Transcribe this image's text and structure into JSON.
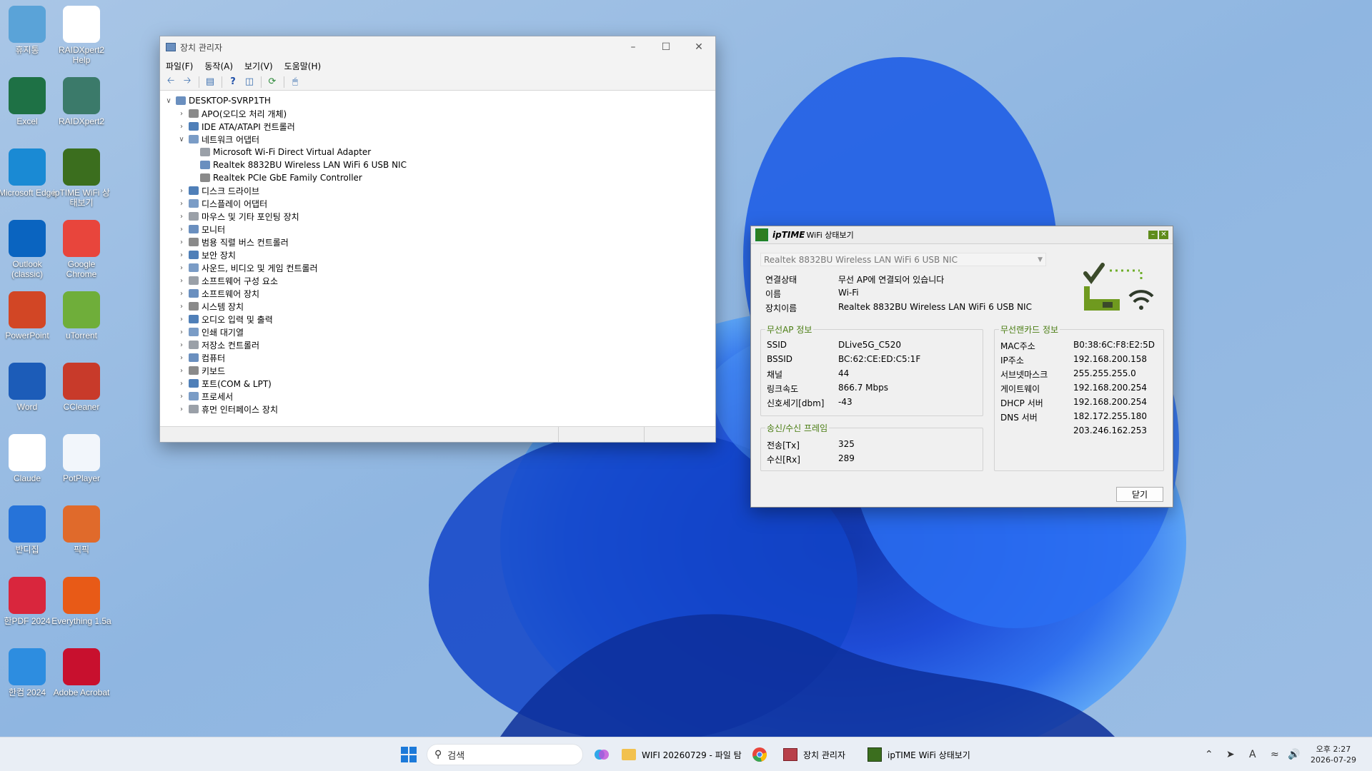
{
  "desktop": {
    "icons": [
      {
        "label": "휴지통",
        "icon": "recycle-bin-icon",
        "color": "#5aa3d8"
      },
      {
        "label": "RAIDXpert2 Help",
        "icon": "pdf-icon",
        "color": "#ffffff"
      },
      {
        "label": "Excel",
        "icon": "excel-icon",
        "color": "#1e7145"
      },
      {
        "label": "RAIDXpert2",
        "icon": "raidxpert-icon",
        "color": "#3b7a6a"
      },
      {
        "label": "Microsoft Edge",
        "icon": "edge-icon",
        "color": "#1a8ad4"
      },
      {
        "label": "ipTIME WiFi 상태보기",
        "icon": "iptime-icon",
        "color": "#3b6e1e"
      },
      {
        "label": "Outlook (classic)",
        "icon": "outlook-icon",
        "color": "#0a64c0"
      },
      {
        "label": "Google Chrome",
        "icon": "chrome-icon",
        "color": "#e8453c"
      },
      {
        "label": "PowerPoint",
        "icon": "powerpoint-icon",
        "color": "#d24625"
      },
      {
        "label": "uTorrent",
        "icon": "utorrent-icon",
        "color": "#6fae3a"
      },
      {
        "label": "Word",
        "icon": "word-icon",
        "color": "#1c5cb8"
      },
      {
        "label": "CCleaner",
        "icon": "ccleaner-icon",
        "color": "#c83a2a"
      },
      {
        "label": "Claude",
        "icon": "claude-icon",
        "color": "#ffffff"
      },
      {
        "label": "PotPlayer",
        "icon": "potplayer-icon",
        "color": "#f2f6fb"
      },
      {
        "label": "한PDF 2024",
        "icon": "hanpdf-icon",
        "color": "#d9263d"
      },
      {
        "label": "Everything 1.5a",
        "icon": "everything-icon",
        "color": "#e85a17"
      },
      {
        "label": "한컴 2024",
        "icon": "hancom-icon",
        "color": "#2d8de0"
      },
      {
        "label": "Adobe Acrobat",
        "icon": "acrobat-icon",
        "color": "#c8102e"
      },
      {
        "label": "반디집",
        "icon": "bandizip-icon",
        "color": "#2673d9"
      },
      {
        "label": "픽픽",
        "icon": "picpick-icon",
        "color": "#e06a2b"
      }
    ]
  },
  "devmgr": {
    "title": "장치 관리자",
    "menu": [
      "파일(F)",
      "동작(A)",
      "보기(V)",
      "도움말(H)"
    ],
    "tree": [
      {
        "label": "DESKTOP-SVRP1TH",
        "level": 0,
        "exp": "v"
      },
      {
        "label": "APO(오디오 처리 개체)",
        "level": 1,
        "exp": ">"
      },
      {
        "label": "IDE ATA/ATAPI 컨트롤러",
        "level": 1,
        "exp": ">"
      },
      {
        "label": "네트워크 어댑터",
        "level": 1,
        "exp": "v"
      },
      {
        "label": "Microsoft Wi-Fi Direct Virtual Adapter",
        "level": 2,
        "exp": ""
      },
      {
        "label": "Realtek 8832BU Wireless LAN WiFi 6 USB NIC",
        "level": 2,
        "exp": ""
      },
      {
        "label": "Realtek PCIe GbE Family Controller",
        "level": 2,
        "exp": ""
      },
      {
        "label": "디스크 드라이브",
        "level": 1,
        "exp": ">"
      },
      {
        "label": "디스플레이 어댑터",
        "level": 1,
        "exp": ">"
      },
      {
        "label": "마우스 및 기타 포인팅 장치",
        "level": 1,
        "exp": ">"
      },
      {
        "label": "모니터",
        "level": 1,
        "exp": ">"
      },
      {
        "label": "범용 직렬 버스 컨트롤러",
        "level": 1,
        "exp": ">"
      },
      {
        "label": "보안 장치",
        "level": 1,
        "exp": ">"
      },
      {
        "label": "사운드, 비디오 및 게임 컨트롤러",
        "level": 1,
        "exp": ">"
      },
      {
        "label": "소프트웨어 구성 요소",
        "level": 1,
        "exp": ">"
      },
      {
        "label": "소프트웨어 장치",
        "level": 1,
        "exp": ">"
      },
      {
        "label": "시스템 장치",
        "level": 1,
        "exp": ">"
      },
      {
        "label": "오디오 입력 및 출력",
        "level": 1,
        "exp": ">"
      },
      {
        "label": "인쇄 대기열",
        "level": 1,
        "exp": ">"
      },
      {
        "label": "저장소 컨트롤러",
        "level": 1,
        "exp": ">"
      },
      {
        "label": "컴퓨터",
        "level": 1,
        "exp": ">"
      },
      {
        "label": "키보드",
        "level": 1,
        "exp": ">"
      },
      {
        "label": "포트(COM & LPT)",
        "level": 1,
        "exp": ">"
      },
      {
        "label": "프로세서",
        "level": 1,
        "exp": ">"
      },
      {
        "label": "휴먼 인터페이스 장치",
        "level": 1,
        "exp": ">"
      }
    ]
  },
  "iptime": {
    "brand": "ipTIME",
    "title_suffix": "WiFi 상태보기",
    "adapter": "Realtek 8832BU Wireless LAN WiFi 6 USB NIC",
    "status": [
      {
        "k": "연결상태",
        "v": "무선 AP에 연결되어 있습니다"
      },
      {
        "k": "이름",
        "v": "Wi-Fi"
      },
      {
        "k": "장치이름",
        "v": "Realtek 8832BU Wireless LAN WiFi 6 USB NIC"
      }
    ],
    "ap_group_label": "무선AP 정보",
    "ap": [
      {
        "k": "SSID",
        "v": "DLive5G_C520"
      },
      {
        "k": "BSSID",
        "v": "BC:62:CE:ED:C5:1F"
      },
      {
        "k": "채널",
        "v": "44"
      },
      {
        "k": "링크속도",
        "v": "866.7 Mbps"
      },
      {
        "k": "신호세기[dbm]",
        "v": "-43"
      }
    ],
    "frame_group_label": "송신/수신 프레임",
    "frames": [
      {
        "k": "전송[Tx]",
        "v": "325"
      },
      {
        "k": "수신[Rx]",
        "v": "289"
      }
    ],
    "card_group_label": "무선랜카드 정보",
    "card": [
      {
        "k": "MAC주소",
        "v": "B0:38:6C:F8:E2:5D"
      },
      {
        "k": "IP주소",
        "v": "192.168.200.158"
      },
      {
        "k": "서브넷마스크",
        "v": "255.255.255.0"
      },
      {
        "k": "게이트웨이",
        "v": "192.168.200.254"
      },
      {
        "k": "DHCP 서버",
        "v": "192.168.200.254"
      },
      {
        "k": "DNS 서버",
        "v": "182.172.255.180"
      },
      {
        "k": "",
        "v": "203.246.162.253"
      }
    ],
    "close_label": "닫기"
  },
  "taskbar": {
    "search_placeholder": "검색",
    "apps": [
      {
        "label": "WIFI 20260729 - 파일 탐",
        "icon": "folder-icon"
      },
      {
        "label": "",
        "icon": "chrome-icon"
      },
      {
        "label": "장치 관리자",
        "icon": "device-manager-icon"
      },
      {
        "label": "ipTIME WiFi 상태보기",
        "icon": "iptime-icon"
      }
    ],
    "clock_time": "오후 2:27",
    "clock_date": "2026-07-29"
  },
  "colors": {
    "accent": "#4a7d12",
    "wallpaper": "#4d8ad6"
  }
}
